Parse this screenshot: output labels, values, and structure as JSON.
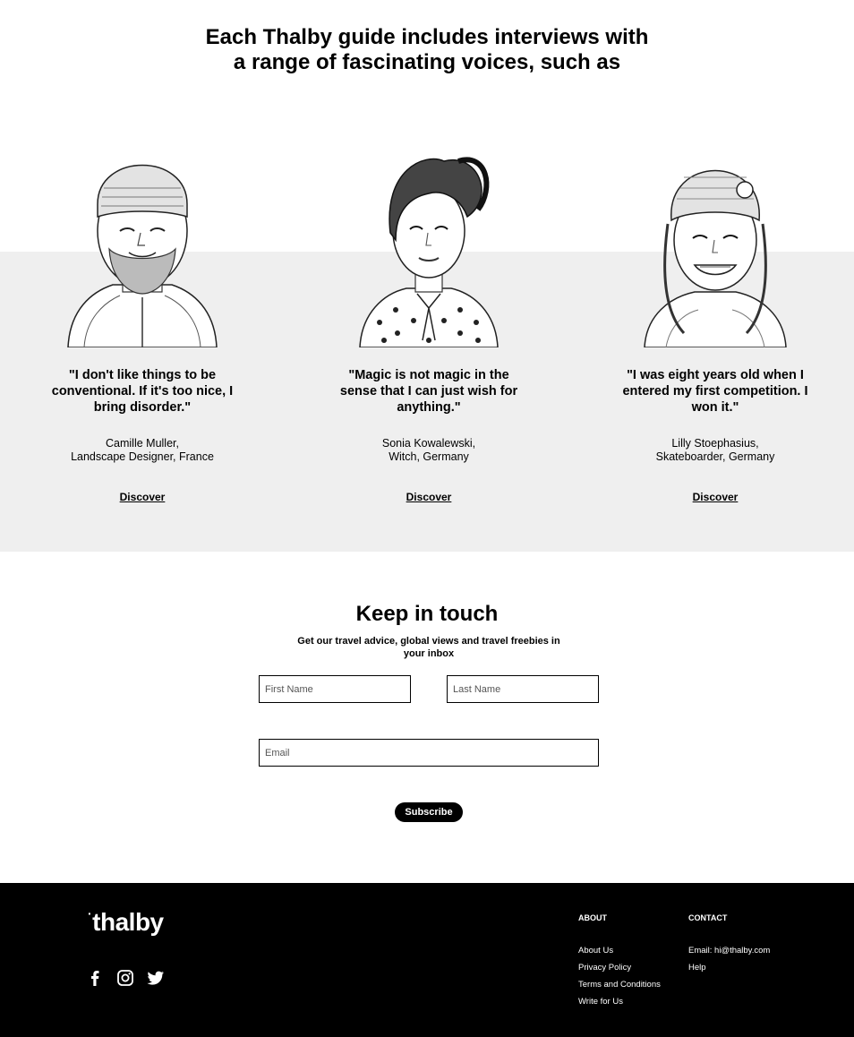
{
  "headline": {
    "line1": "Each Thalby guide includes interviews with",
    "line2": "a range of fascinating voices, such as"
  },
  "voices": [
    {
      "quote": "\"I don't like things to be conventional. If it's too nice, I bring disorder.\"",
      "name": "Camille Muller,",
      "role": "Landscape Designer, France",
      "link": "Discover"
    },
    {
      "quote": "\"Magic is not magic in the sense that I can just wish for anything.\"",
      "name": "Sonia Kowalewski,",
      "role": "Witch, Germany",
      "link": "Discover"
    },
    {
      "quote": "\"I was eight years old when I entered my first competition. I won it.\"",
      "name": "Lilly Stoephasius,",
      "role": "Skateboarder, Germany",
      "link": "Discover"
    }
  ],
  "newsletter": {
    "title": "Keep in touch",
    "subtitle": "Get our travel advice, global views and travel freebies in your inbox",
    "first_name_placeholder": "First Name",
    "last_name_placeholder": "Last Name",
    "email_placeholder": "Email",
    "button": "Subscribe"
  },
  "footer": {
    "logo": "thalby",
    "social": [
      "facebook-icon",
      "instagram-icon",
      "twitter-icon"
    ],
    "about": {
      "heading": "ABOUT",
      "links": [
        "About Us",
        "Privacy Policy",
        "Terms and Conditions",
        "Write for Us"
      ]
    },
    "contact": {
      "heading": "CONTACT",
      "links": [
        "Email: hi@thalby.com",
        "Help"
      ]
    }
  },
  "colors": {
    "band": "#efefef",
    "footer_bg": "#000000",
    "button_bg": "#000000"
  }
}
